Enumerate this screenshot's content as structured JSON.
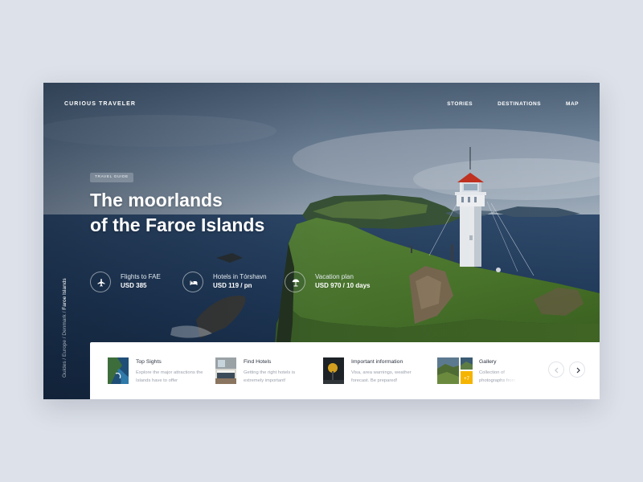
{
  "header": {
    "brand": "CURIOUS TRAVELER",
    "nav": [
      "STORIES",
      "DESTINATIONS",
      "MAP"
    ]
  },
  "hero": {
    "tag": "TRAVEL GUIDE",
    "title_line1": "The moorlands",
    "title_line2": "of the Faroe Islands"
  },
  "stats": [
    {
      "icon": "airplane-icon",
      "label": "Flights to FAE",
      "value": "USD 385"
    },
    {
      "icon": "bed-icon",
      "label": "Hotels in Tórshavn",
      "value": "USD 119 / pn"
    },
    {
      "icon": "beach-umbrella-icon",
      "label": "Vacation plan",
      "value": "USD 970 / 10 days"
    }
  ],
  "breadcrumb": {
    "items": [
      "Guides",
      "Europe",
      "Denmark"
    ],
    "separator": " / ",
    "current": "Faroe Islands"
  },
  "cards": [
    {
      "title": "Top Sights",
      "desc": "Explore the major attractions the Islands have to offer"
    },
    {
      "title": "Find Hotels",
      "desc": "Getting the right hotels is extremely important!"
    },
    {
      "title": "Important information",
      "desc": "Visa, area warnings, weather forecast. Be prepared!"
    },
    {
      "title": "Gallery",
      "desc": "Collection of photographs from our authors & readers",
      "badge": "+7"
    }
  ],
  "colors": {
    "page_bg": "#dde1e9",
    "lighthouse_roof": "#c8321f",
    "badge": "#f5b400",
    "card_title": "#2b3240",
    "card_desc": "#9aa1ad"
  }
}
